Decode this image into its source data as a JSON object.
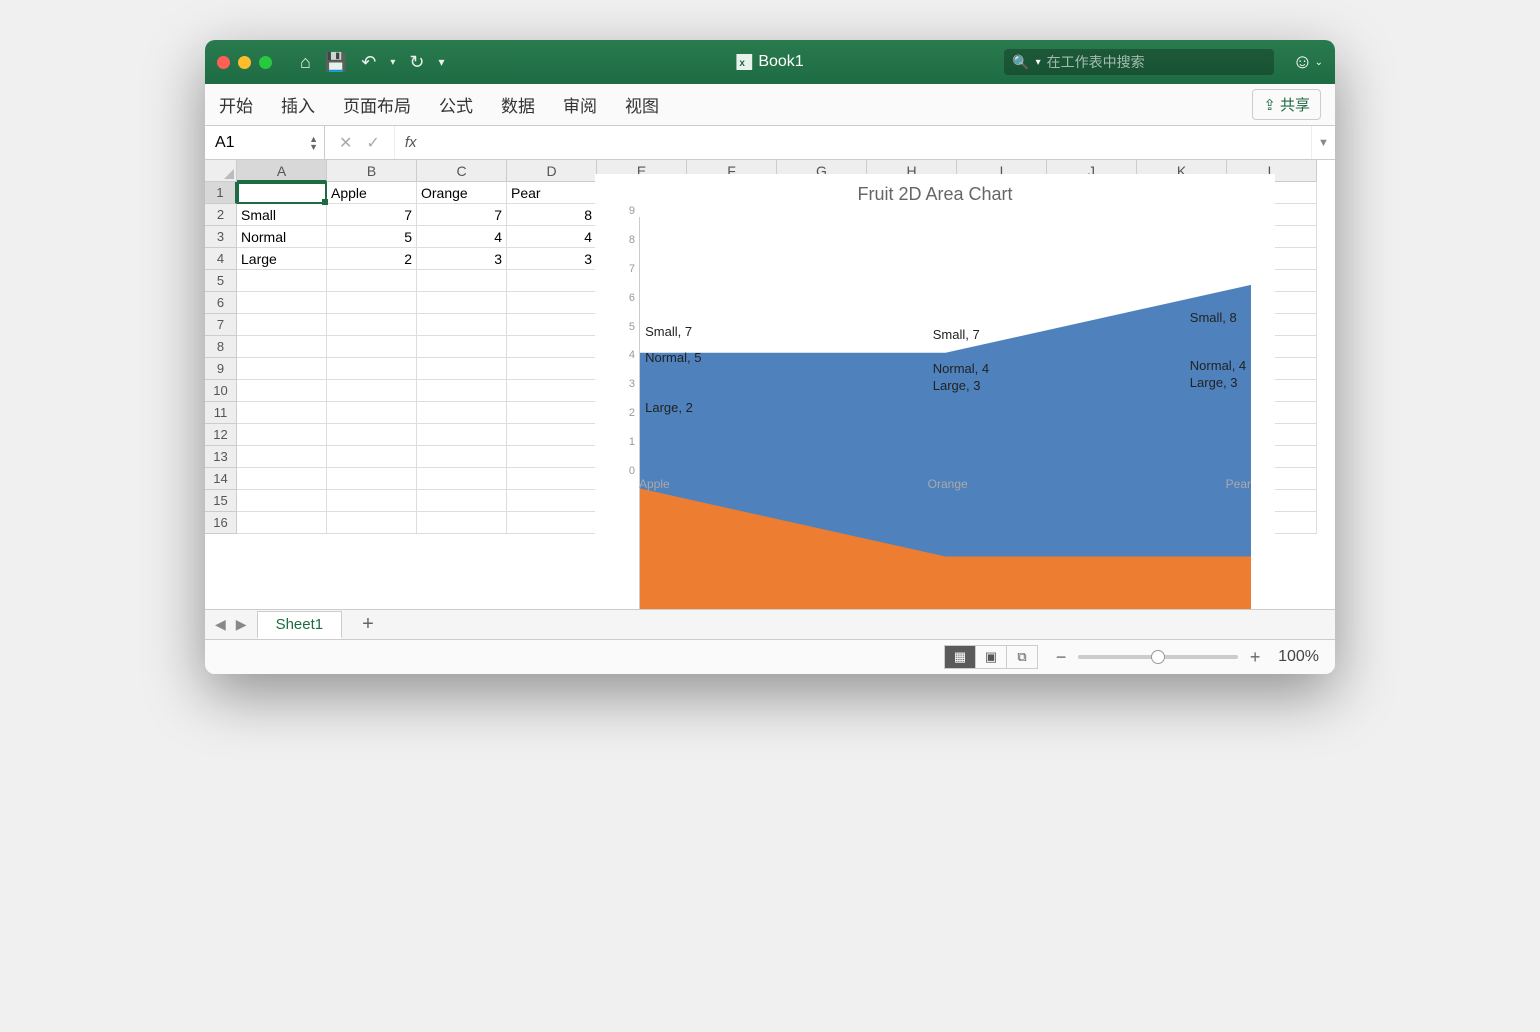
{
  "window": {
    "title": "Book1"
  },
  "search": {
    "placeholder": "在工作表中搜索"
  },
  "ribbon": {
    "tabs": [
      "开始",
      "插入",
      "页面布局",
      "公式",
      "数据",
      "审阅",
      "视图"
    ],
    "share_label": "共享"
  },
  "formula_bar": {
    "name_box": "A1",
    "fx_label": "fx",
    "value": ""
  },
  "grid": {
    "columns": [
      "A",
      "B",
      "C",
      "D",
      "E",
      "F",
      "G",
      "H",
      "I",
      "J",
      "K",
      "L"
    ],
    "row_count": 16,
    "active_cell": "A1",
    "data": [
      {
        "r": 1,
        "cells": [
          "",
          "Apple",
          "Orange",
          "Pear"
        ]
      },
      {
        "r": 2,
        "cells": [
          "Small",
          "7",
          "7",
          "8"
        ]
      },
      {
        "r": 3,
        "cells": [
          "Normal",
          "5",
          "4",
          "4"
        ]
      },
      {
        "r": 4,
        "cells": [
          "Large",
          "2",
          "3",
          "3"
        ]
      }
    ]
  },
  "sheet_tabs": {
    "active": "Sheet1"
  },
  "status": {
    "zoom": "100%"
  },
  "chart_data": {
    "type": "area",
    "title": "Fruit 2D Area Chart",
    "categories": [
      "Apple",
      "Orange",
      "Pear"
    ],
    "series": [
      {
        "name": "Small",
        "values": [
          7,
          7,
          8
        ],
        "color": "#4f81bd"
      },
      {
        "name": "Normal",
        "values": [
          5,
          4,
          4
        ],
        "color": "#ed7d31"
      },
      {
        "name": "Large",
        "values": [
          2,
          3,
          3
        ],
        "color": "#a5a5a5"
      }
    ],
    "ylim": [
      0,
      9
    ],
    "y_ticks": [
      0,
      1,
      2,
      3,
      4,
      5,
      6,
      7,
      8,
      9
    ],
    "data_labels": [
      {
        "text": "Small, 7",
        "x_pct": 1,
        "y_val": 5.2
      },
      {
        "text": "Normal, 5",
        "x_pct": 1,
        "y_val": 4.3
      },
      {
        "text": "Large, 2",
        "x_pct": 1,
        "y_val": 2.5
      },
      {
        "text": "Small, 7",
        "x_pct": 48,
        "y_val": 5.1
      },
      {
        "text": "Normal, 4",
        "x_pct": 48,
        "y_val": 3.9
      },
      {
        "text": "Large, 3",
        "x_pct": 48,
        "y_val": 3.3
      },
      {
        "text": "Small, 8",
        "x_pct": 90,
        "y_val": 5.7
      },
      {
        "text": "Normal, 4",
        "x_pct": 90,
        "y_val": 4.0
      },
      {
        "text": "Large, 3",
        "x_pct": 90,
        "y_val": 3.4
      }
    ],
    "legend_position": "bottom"
  }
}
